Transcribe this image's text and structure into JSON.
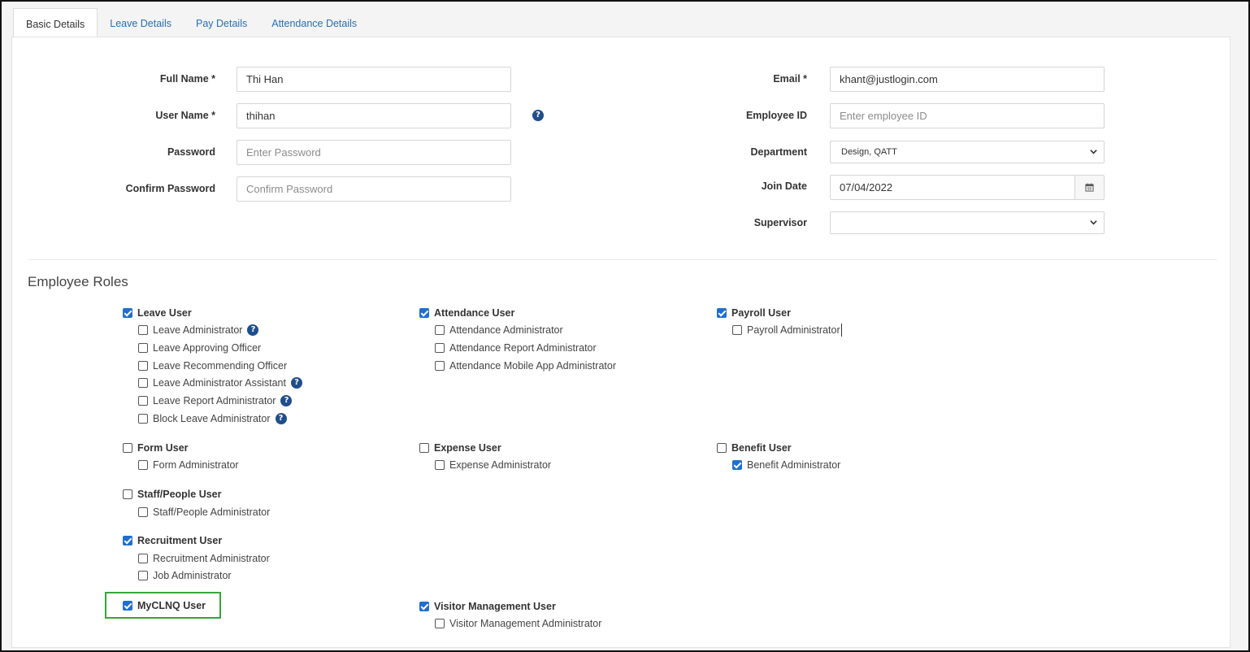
{
  "tabs": [
    {
      "label": "Basic Details",
      "active": true
    },
    {
      "label": "Leave Details",
      "active": false
    },
    {
      "label": "Pay Details",
      "active": false
    },
    {
      "label": "Attendance Details",
      "active": false
    }
  ],
  "form": {
    "full_name": {
      "label": "Full Name *",
      "value": "Thi Han"
    },
    "user_name": {
      "label": "User Name *",
      "value": "thihan"
    },
    "password": {
      "label": "Password",
      "placeholder": "Enter Password"
    },
    "confirm_password": {
      "label": "Confirm Password",
      "placeholder": "Confirm Password"
    },
    "email": {
      "label": "Email *",
      "value": "khant@justlogin.com"
    },
    "employee_id": {
      "label": "Employee ID",
      "placeholder": "Enter employee ID"
    },
    "department": {
      "label": "Department",
      "value": "Design, QATT"
    },
    "join_date": {
      "label": "Join Date",
      "value": "07/04/2022"
    },
    "supervisor": {
      "label": "Supervisor",
      "value": ""
    }
  },
  "roles": {
    "title": "Employee Roles",
    "leave_user": "Leave User",
    "leave_admin": "Leave Administrator",
    "leave_approving": "Leave Approving Officer",
    "leave_recommending": "Leave Recommending Officer",
    "leave_admin_assistant": "Leave Administrator Assistant",
    "leave_report_admin": "Leave Report Administrator",
    "block_leave_admin": "Block Leave Administrator",
    "attendance_user": "Attendance User",
    "attendance_admin": "Attendance Administrator",
    "attendance_report_admin": "Attendance Report Administrator",
    "attendance_mobile_admin": "Attendance Mobile App Administrator",
    "payroll_user": "Payroll User",
    "payroll_admin": "Payroll Administrator",
    "form_user": "Form User",
    "form_admin": "Form Administrator",
    "expense_user": "Expense User",
    "expense_admin": "Expense Administrator",
    "benefit_user": "Benefit User",
    "benefit_admin": "Benefit Administrator",
    "staff_user": "Staff/People User",
    "staff_admin": "Staff/People Administrator",
    "recruitment_user": "Recruitment User",
    "recruitment_admin": "Recruitment Administrator",
    "job_admin": "Job Administrator",
    "myclnq_user": "MyCLNQ User",
    "visitor_user": "Visitor Management User",
    "visitor_admin": "Visitor Management Administrator"
  },
  "icons": {
    "help": "?"
  },
  "colors": {
    "accent": "#1f6fd1",
    "highlight": "#37a53b",
    "link": "#2a6fb5"
  }
}
